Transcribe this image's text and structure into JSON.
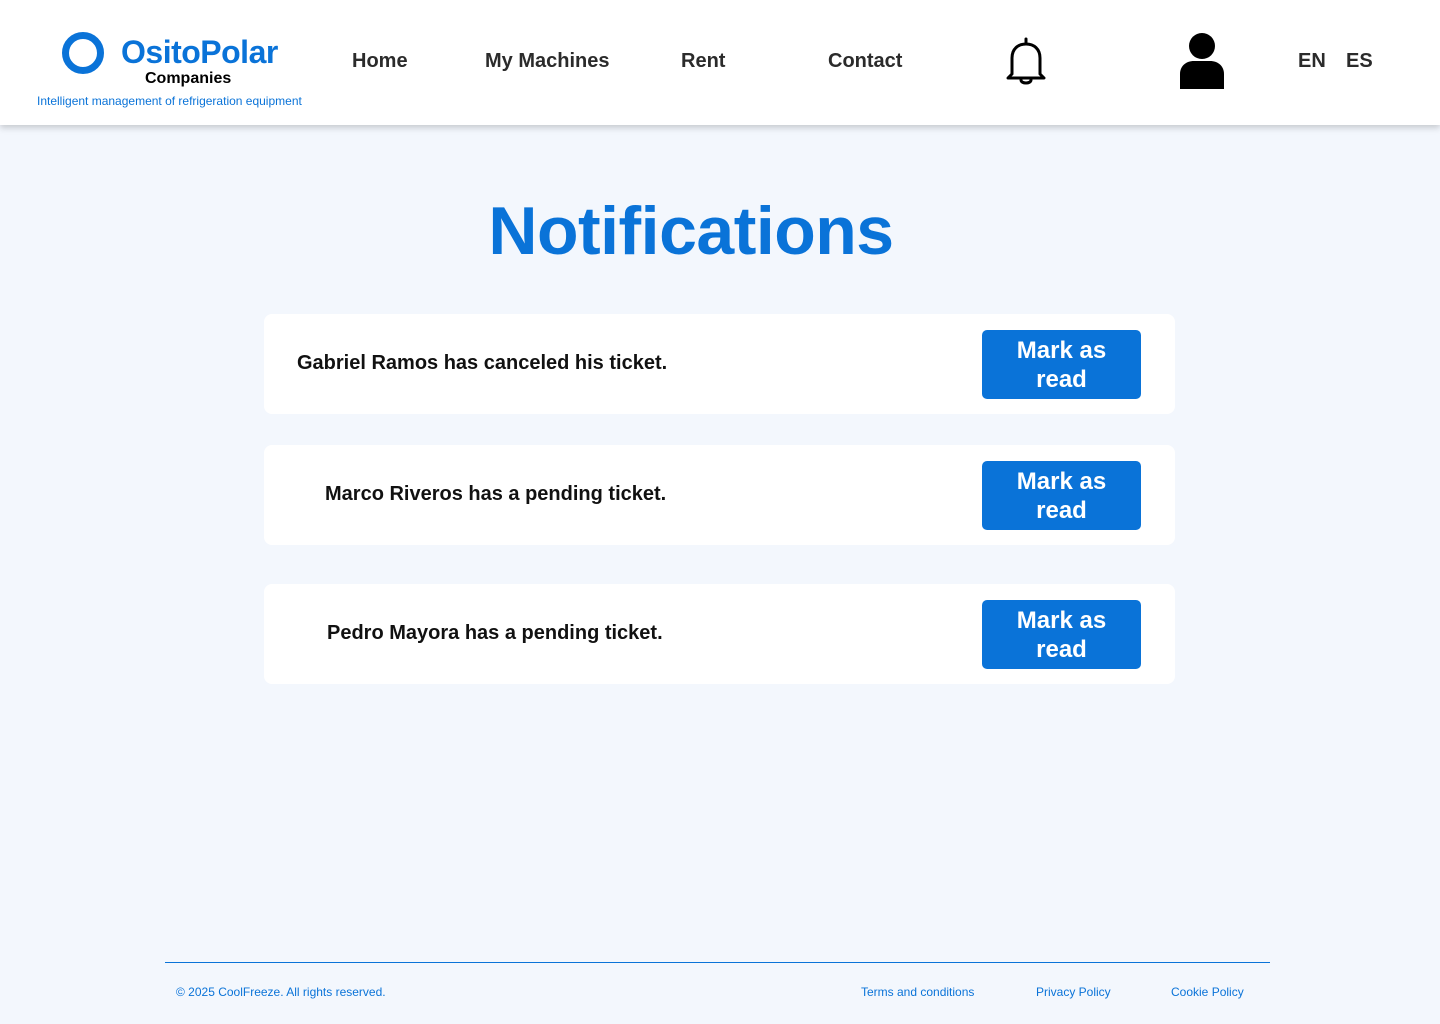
{
  "header": {
    "logo": {
      "name": "OsitoPolar",
      "subtitle": "Companies",
      "tagline": "Intelligent management of refrigeration equipment"
    },
    "nav": [
      {
        "label": "Home"
      },
      {
        "label": "My Machines"
      },
      {
        "label": "Rent"
      },
      {
        "label": "Contact"
      }
    ],
    "icons": {
      "notifications": "bell-icon",
      "profile": "user-icon"
    },
    "languages": [
      "EN",
      "ES"
    ]
  },
  "main": {
    "title": "Notifications",
    "notifications": [
      {
        "message": "Gabriel Ramos has canceled his ticket.",
        "action": "Mark as read"
      },
      {
        "message": "Marco Riveros has a pending ticket.",
        "action": "Mark as read"
      },
      {
        "message": "Pedro Mayora has a pending ticket.",
        "action": "Mark as read"
      }
    ]
  },
  "footer": {
    "copyright": "© 2025 CoolFreeze. All rights reserved.",
    "links": [
      {
        "label": "Terms and conditions"
      },
      {
        "label": "Privacy Policy"
      },
      {
        "label": "Cookie Policy"
      }
    ]
  },
  "colors": {
    "accent": "#0a73d8",
    "background": "#f3f7fd",
    "card": "#ffffff",
    "text": "#111111"
  }
}
